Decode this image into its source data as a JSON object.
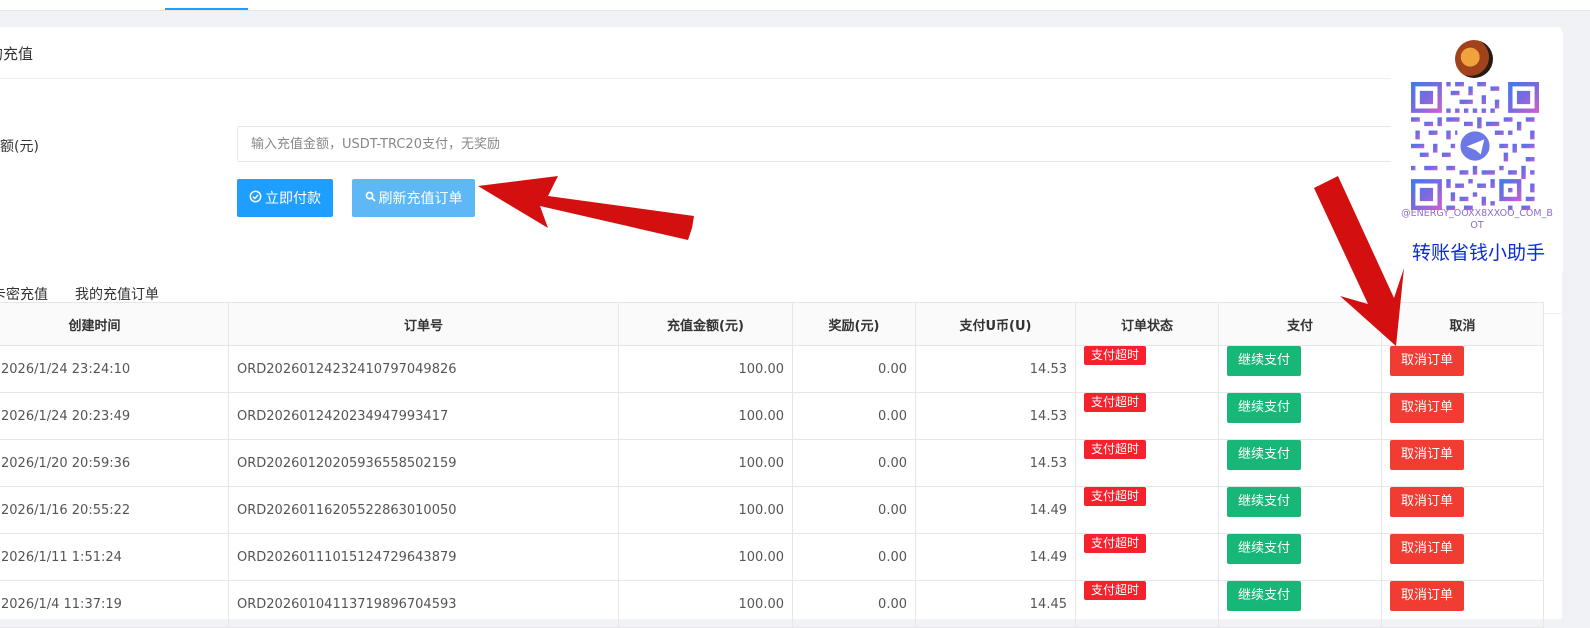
{
  "page": {
    "title": "的充值"
  },
  "form": {
    "amount_label": "金额(元)",
    "amount_placeholder": "输入充值金额，USDT-TRC20支付，无奖励",
    "pay_button": "立即付款",
    "refresh_button": "刷新充值订单"
  },
  "tabs": [
    {
      "label": "卡密充值"
    },
    {
      "label": "我的充值订单",
      "active": true
    }
  ],
  "table": {
    "headers": [
      "创建时间",
      "订单号",
      "充值金额(元)",
      "奖励(元)",
      "支付U币(U)",
      "订单状态",
      "支付",
      "取消"
    ],
    "rows": [
      {
        "time": "2026/1/24 23:24:10",
        "order_no": "ORD20260124232410797049826",
        "amount": "100.00",
        "bonus": "0.00",
        "usdt": "14.53",
        "status": "支付超时",
        "pay": "继续支付",
        "cancel": "取消订单"
      },
      {
        "time": "2026/1/24 20:23:49",
        "order_no": "ORD20260124202349479934​17",
        "amount": "100.00",
        "bonus": "0.00",
        "usdt": "14.53",
        "status": "支付超时",
        "pay": "继续支付",
        "cancel": "取消订单"
      },
      {
        "time": "2026/1/20 20:59:36",
        "order_no": "ORD20260120205936558502159",
        "amount": "100.00",
        "bonus": "0.00",
        "usdt": "14.53",
        "status": "支付超时",
        "pay": "继续支付",
        "cancel": "取消订单"
      },
      {
        "time": "2026/1/16 20:55:22",
        "order_no": "ORD20260116205522863010050",
        "amount": "100.00",
        "bonus": "0.00",
        "usdt": "14.49",
        "status": "支付超时",
        "pay": "继续支付",
        "cancel": "取消订单"
      },
      {
        "time": "2026/1/11 1:51:24",
        "order_no": "ORD20260111015124729643879",
        "amount": "100.00",
        "bonus": "0.00",
        "usdt": "14.49",
        "status": "支付超时",
        "pay": "继续支付",
        "cancel": "取消订单"
      },
      {
        "time": "2026/1/4 11:37:19",
        "order_no": "ORD20260104113719896704593",
        "amount": "100.00",
        "bonus": "0.00",
        "usdt": "14.45",
        "status": "支付超时",
        "pay": "继续支付",
        "cancel": "取消订单"
      }
    ]
  },
  "qr_panel": {
    "handle": "@ENERGY_OOXX8XXOO_COM_BOT",
    "caption": "转账省钱小助手"
  },
  "colors": {
    "primary": "#1e9fff",
    "refresh": "#5fb8f6",
    "success_green": "#16b777",
    "danger_red": "#f03c32",
    "value_green": "#089d18",
    "arrow_red": "#d40f0f"
  }
}
